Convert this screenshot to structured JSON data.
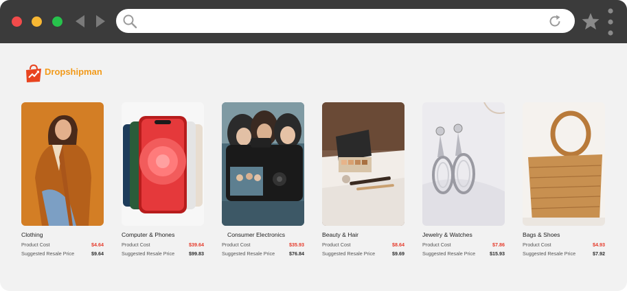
{
  "browser": {
    "url_value": "",
    "icons": [
      "close-dot",
      "minimize-dot",
      "maximize-dot",
      "back-arrow-icon",
      "forward-arrow-icon",
      "search-icon",
      "reload-icon",
      "star-icon",
      "kebab-menu-icon"
    ]
  },
  "brand": {
    "name": "Dropshipman",
    "color": "#f29a1a",
    "icon": "shopping-bag-icon"
  },
  "colors": {
    "cost": "#e53a2a",
    "resale": "#2b2b2b",
    "chrome": "#3b3b3b",
    "page": "#f2f2f2"
  },
  "labels": {
    "product_cost": "Product Cost",
    "resale_price": "Suggested Resale Price"
  },
  "products": [
    {
      "name": "Clothing",
      "cost": "$4.64",
      "resale": "$9.64"
    },
    {
      "name": "Computer & Phones",
      "cost": "$39.64",
      "resale": "$99.83"
    },
    {
      "name": "Consumer Electronics",
      "cost": "$35.93",
      "resale": "$76.84"
    },
    {
      "name": "Beauty & Hair",
      "cost": "$8.64",
      "resale": "$9.69"
    },
    {
      "name": "Jewelry & Watches",
      "cost": "$7.86",
      "resale": "$15.93"
    },
    {
      "name": "Bags & Shoes",
      "cost": "$4.93",
      "resale": "$7.92"
    }
  ]
}
